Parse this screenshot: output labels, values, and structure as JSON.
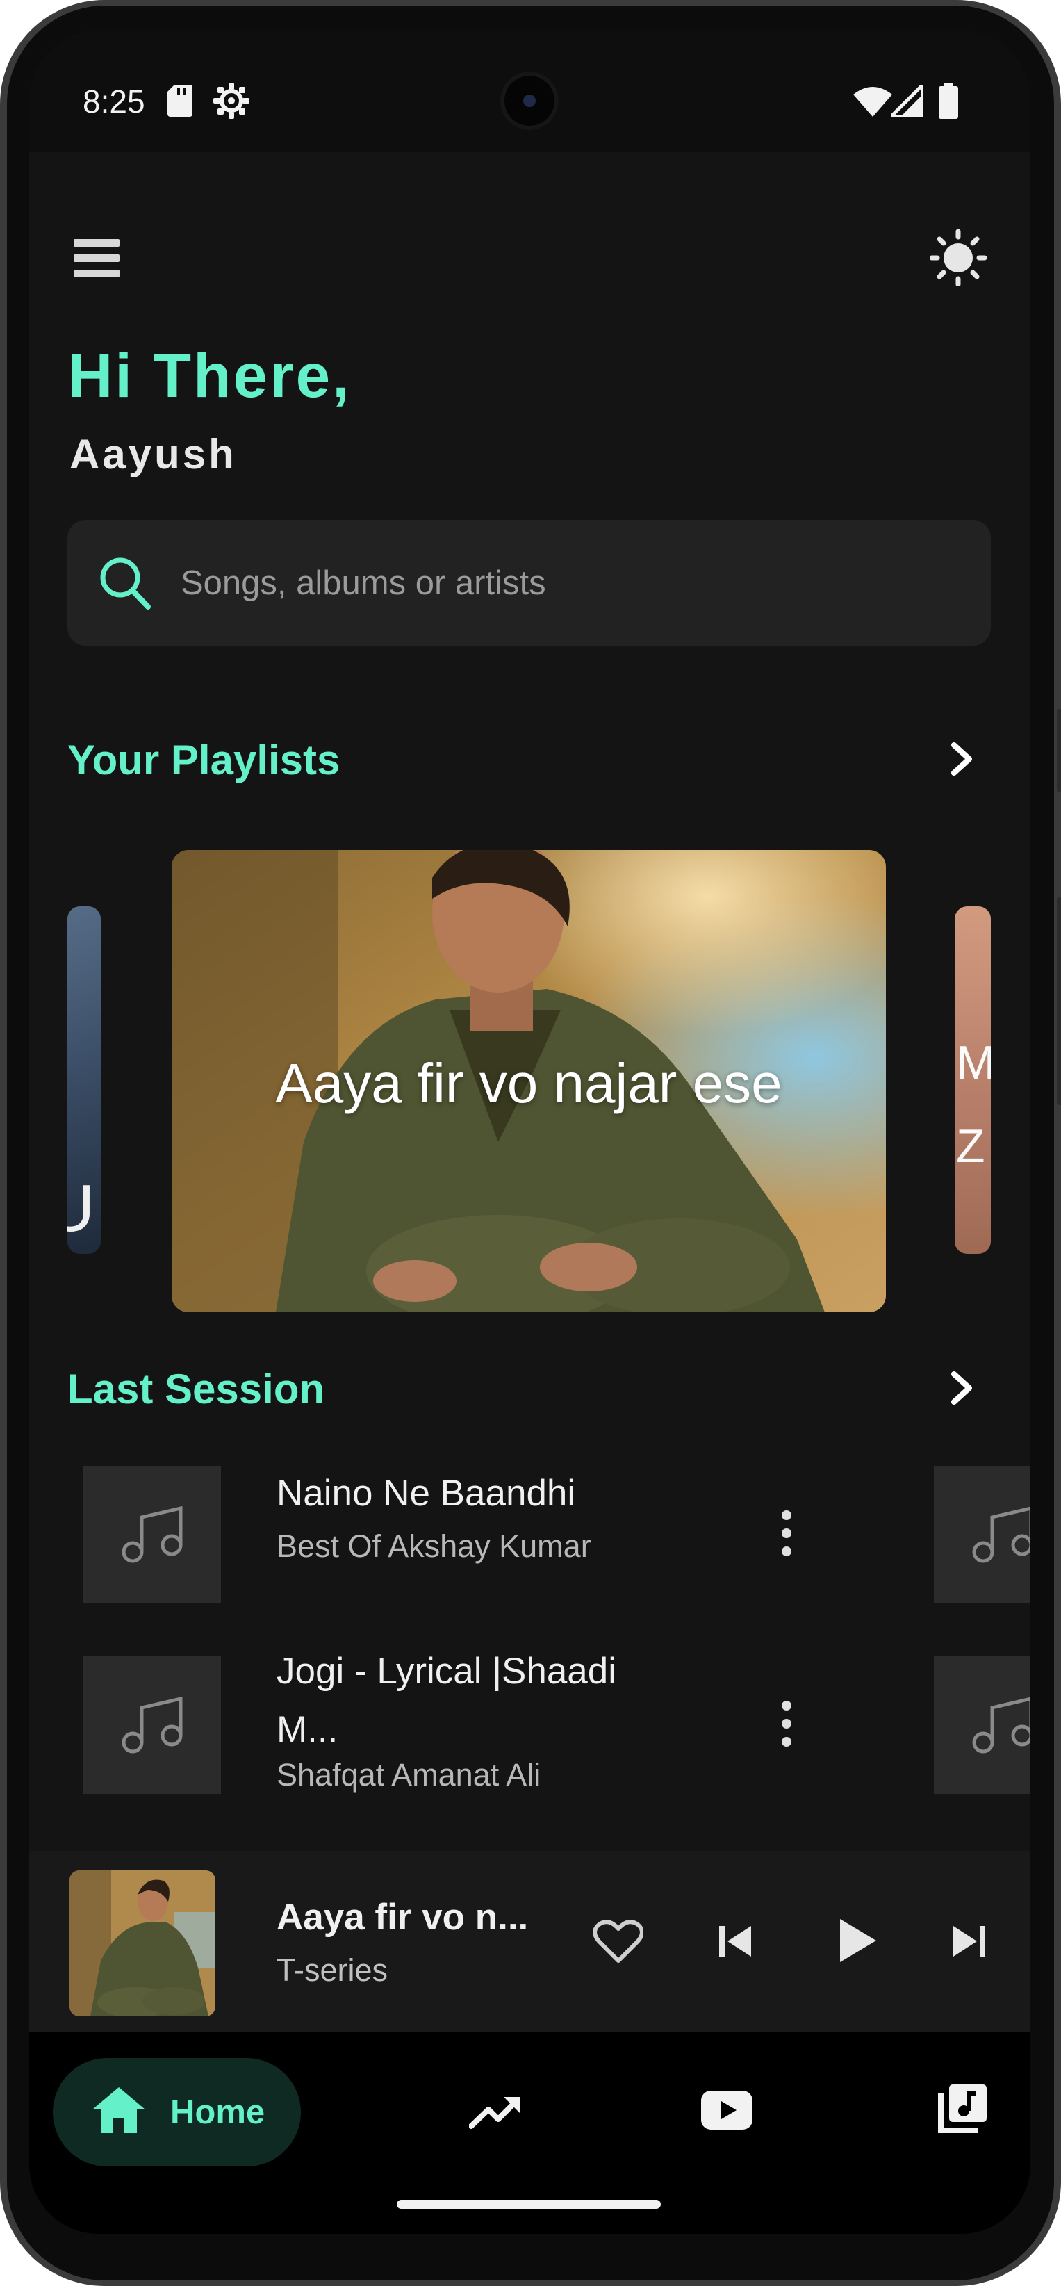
{
  "status_bar": {
    "time": "8:25",
    "icons": [
      "sd-card-icon",
      "settings-gear-icon",
      "wifi-icon",
      "cellular-signal-icon",
      "battery-icon"
    ]
  },
  "header": {
    "menu_icon": "hamburger-menu-icon",
    "theme_icon": "sun-brightness-icon",
    "greeting": "Hi There,",
    "user_name": "Aayush"
  },
  "search": {
    "placeholder": "Songs, albums or artists",
    "value": ""
  },
  "playlists": {
    "title": "Your Playlists",
    "featured_title": "Aaya fir vo najar ese",
    "left_peek_text": "U",
    "right_peek_text": "M\nZ"
  },
  "last_session": {
    "title": "Last Session",
    "songs": [
      {
        "title": "Naino Ne Baandhi",
        "subtitle": "Best Of Akshay Kumar"
      },
      {
        "title": "Jogi - Lyrical |Shaadi M...",
        "subtitle": "Shafqat Amanat Ali"
      }
    ]
  },
  "mini_player": {
    "title": "Aaya fir vo n...",
    "artist": "T-series",
    "controls": [
      "heart-icon",
      "skip-previous-icon",
      "play-icon",
      "skip-next-icon"
    ]
  },
  "bottom_nav": {
    "items": [
      {
        "label": "Home",
        "icon": "home-icon",
        "active": true
      },
      {
        "label": "",
        "icon": "trending-icon",
        "active": false
      },
      {
        "label": "",
        "icon": "youtube-icon",
        "active": false
      },
      {
        "label": "",
        "icon": "library-music-icon",
        "active": false
      }
    ]
  },
  "colors": {
    "accent": "#64f0c8",
    "background": "#141414",
    "surface": "#222222",
    "nav_background": "#000000",
    "nav_active_pill": "#0e2a22"
  }
}
